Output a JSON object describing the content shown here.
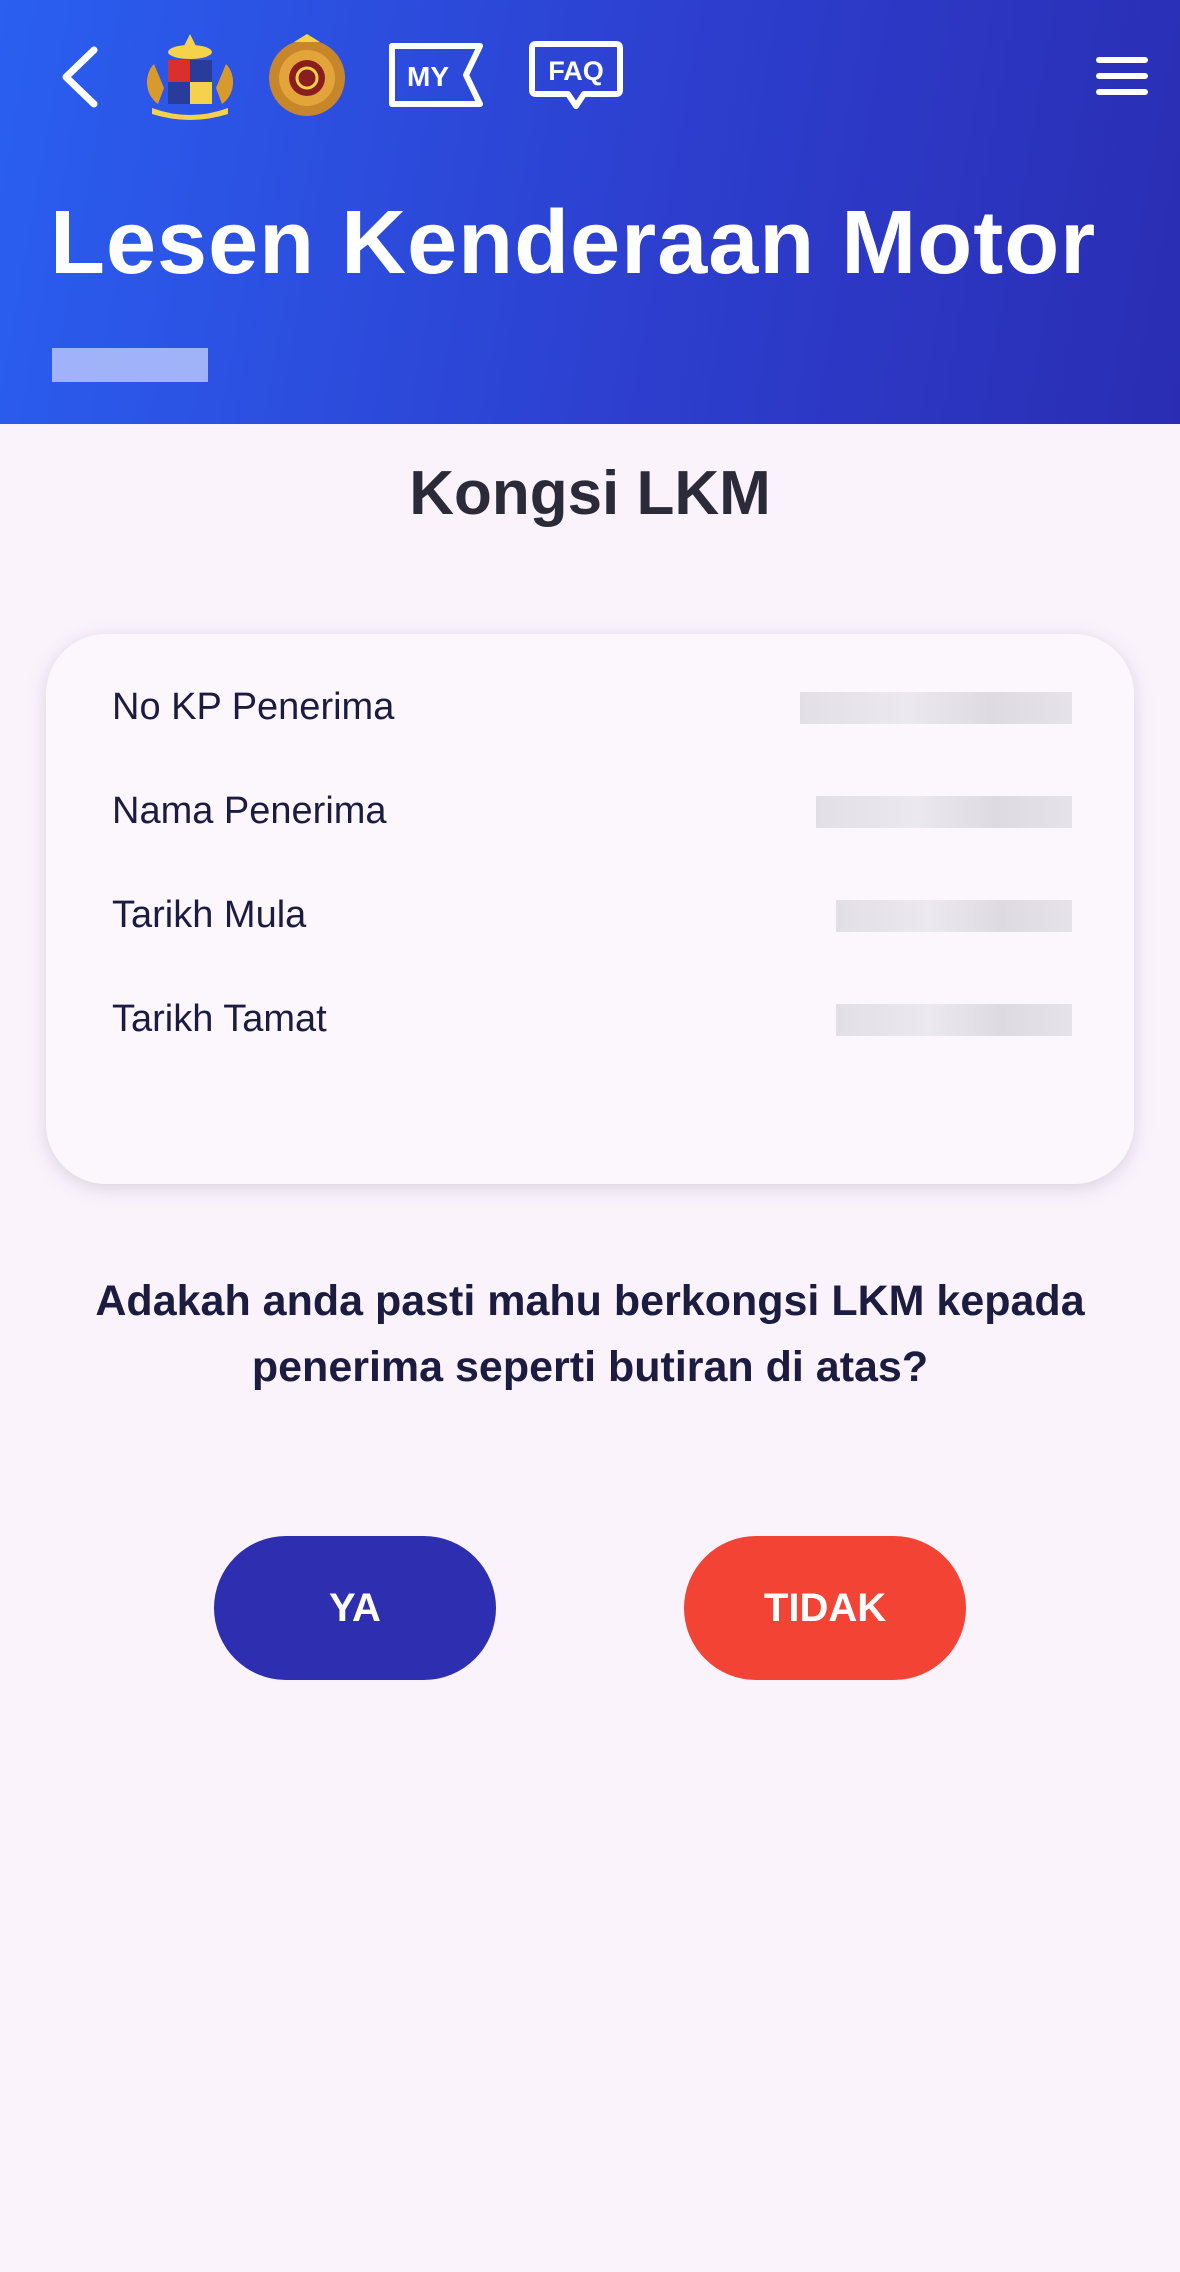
{
  "header": {
    "title": "Lesen Kenderaan Motor",
    "my_label": "MY",
    "faq_label": "FAQ",
    "icons": {
      "back": "chevron-left-icon",
      "crest": "malaysia-crest-icon",
      "agency": "jpj-logo-icon",
      "my": "my-icon",
      "faq": "faq-icon",
      "menu": "hamburger-menu-icon"
    }
  },
  "section_title": "Kongsi LKM",
  "details": {
    "rows": [
      {
        "label": "No KP Penerima"
      },
      {
        "label": "Nama Penerima"
      },
      {
        "label": "Tarikh Mula"
      },
      {
        "label": "Tarikh Tamat"
      }
    ]
  },
  "question": "Adakah anda pasti mahu berkongsi LKM kepada penerima seperti butiran di atas?",
  "buttons": {
    "yes_label": "YA",
    "no_label": "TIDAK"
  },
  "colors": {
    "header_start": "#2a5ff0",
    "header_end": "#2a2db3",
    "yes_button": "#2d2fb0",
    "no_button": "#f24335",
    "background": "#fbf3fc"
  }
}
